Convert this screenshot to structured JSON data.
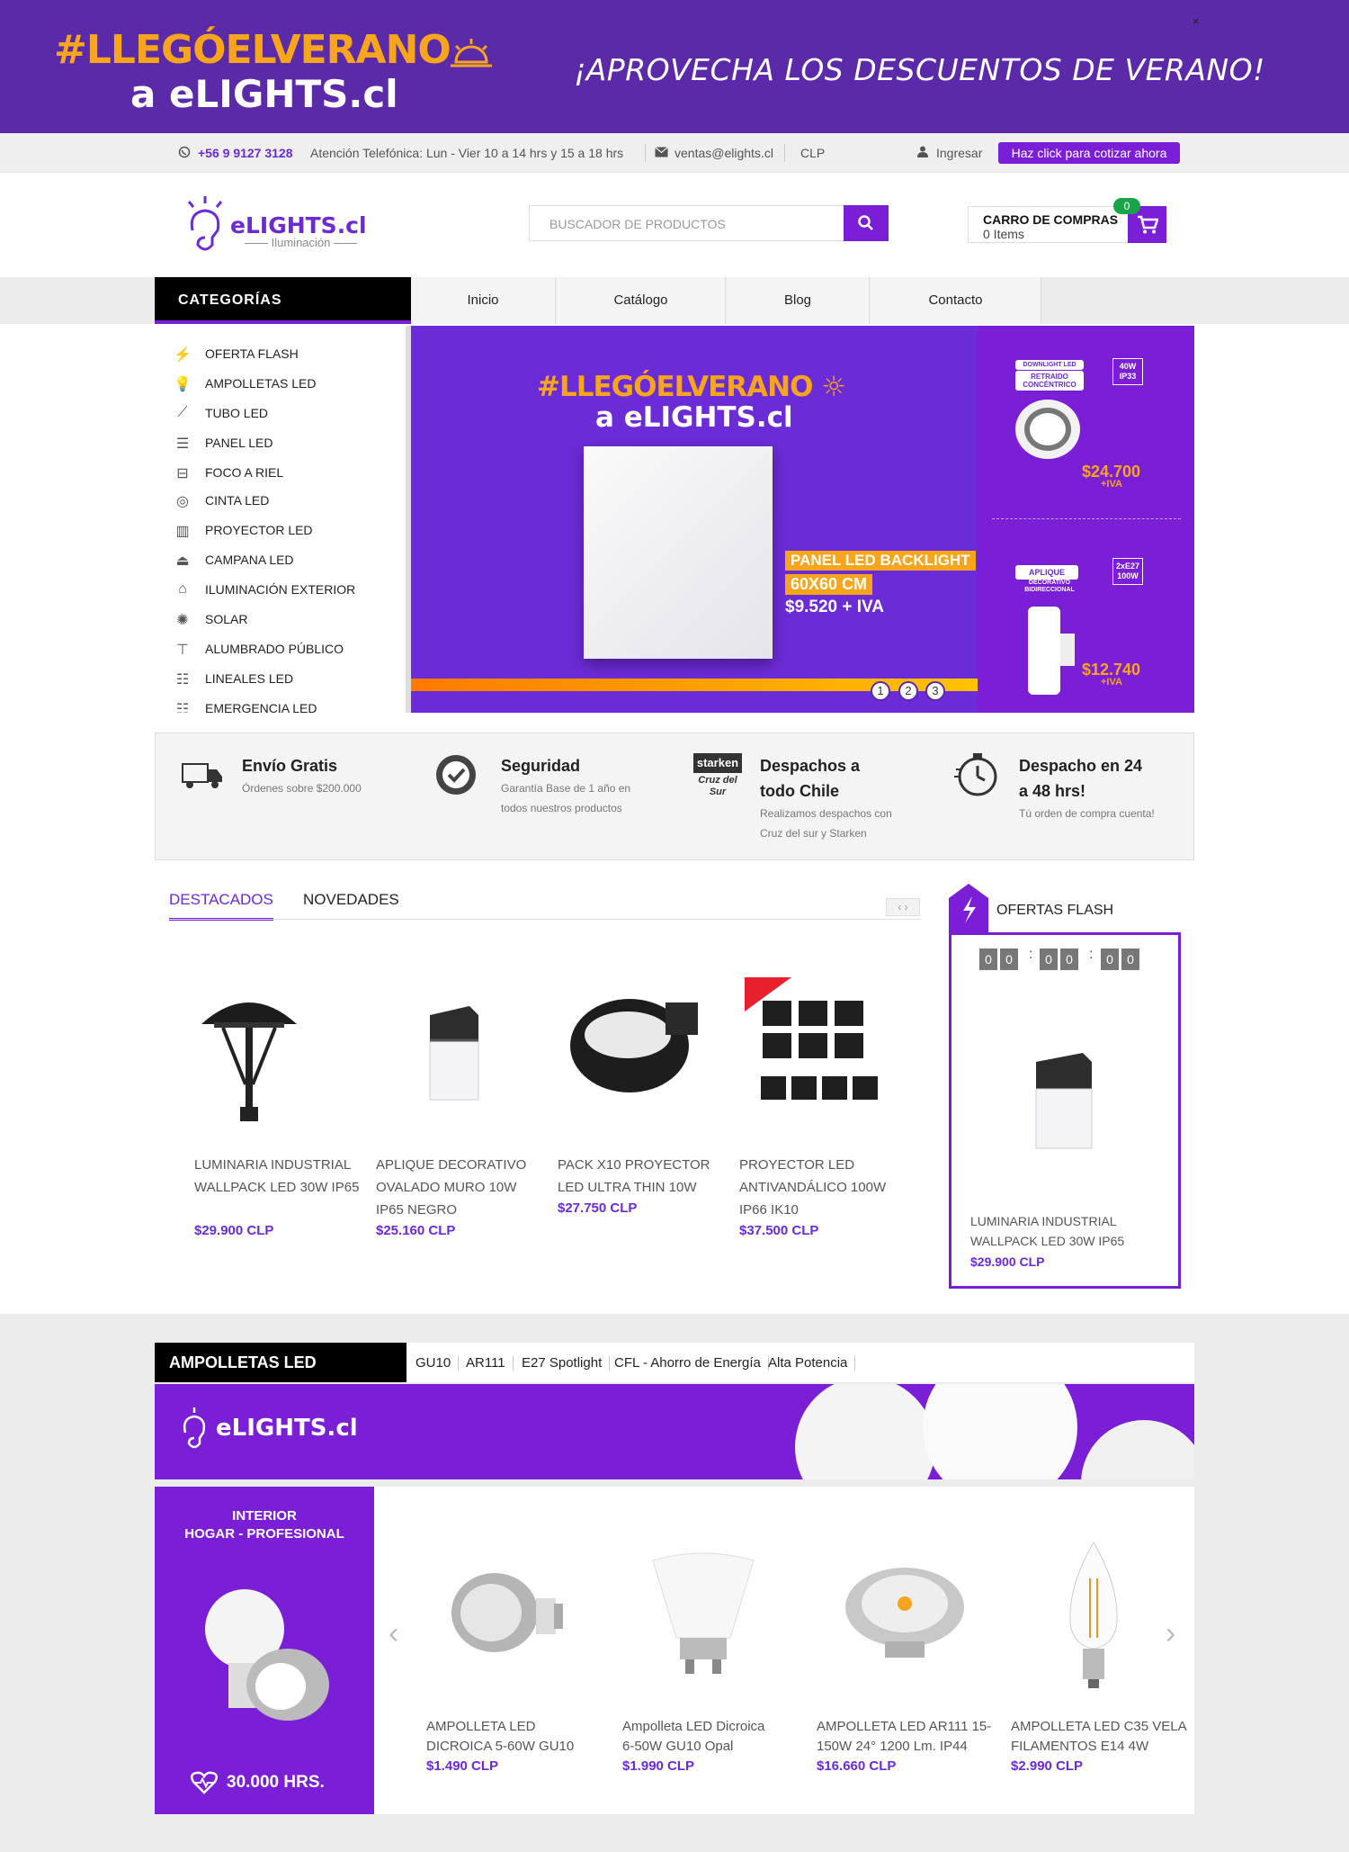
{
  "promo": {
    "tag_prefix": "#LLEGÓEL",
    "tag_highlight": "VERANO",
    "subtitle": "a eLIGHTS.cl",
    "right_text": "¡APROVECHA LOS DESCUENTOS DE VERANO!",
    "close_label": "×"
  },
  "topbar": {
    "phone": "+56 9 9127 3128",
    "hours": "Atención Telefónica: Lun - Vier 10 a 14 hrs y 15 a 18 hrs",
    "email": "ventas@elights.cl",
    "currency": "CLP",
    "login": "Ingresar",
    "quote_button": "Haz click para cotizar ahora"
  },
  "header": {
    "logo_text": "eLIGHTS.cl",
    "logo_sub": "Iluminación",
    "search_placeholder": "BUSCADOR DE PRODUCTOS",
    "cart_title": "CARRO DE COMPRAS",
    "cart_items": "0  Items",
    "cart_count": "0"
  },
  "nav": {
    "categories_label": "CATEGORÍAS",
    "items": [
      "Inicio",
      "Catálogo",
      "Blog",
      "Contacto"
    ]
  },
  "categories": [
    {
      "label": "OFERTA FLASH",
      "icon": "bolt-icon"
    },
    {
      "label": "AMPOLLETAS LED",
      "icon": "bulb-icon"
    },
    {
      "label": "TUBO LED",
      "icon": "tube-icon"
    },
    {
      "label": "PANEL LED",
      "icon": "panel-icon"
    },
    {
      "label": "FOCO A RIEL",
      "icon": "rail-spot-icon"
    },
    {
      "label": "CINTA LED",
      "icon": "strip-icon"
    },
    {
      "label": "PROYECTOR LED",
      "icon": "floodlight-icon"
    },
    {
      "label": "CAMPANA LED",
      "icon": "highbay-icon"
    },
    {
      "label": "ILUMINACIÓN EXTERIOR",
      "icon": "lantern-icon"
    },
    {
      "label": "SOLAR",
      "icon": "sun-icon"
    },
    {
      "label": "ALUMBRADO PÚBLICO",
      "icon": "streetlight-icon"
    },
    {
      "label": "LINEALES LED",
      "icon": "linear-icon"
    },
    {
      "label": "EMERGENCIA LED",
      "icon": "emergency-icon"
    }
  ],
  "hero": {
    "tag_prefix": "#LLEGÓEL",
    "tag_highlight": "VERANO",
    "subtitle": "a eLIGHTS.cl",
    "line1": "PANEL LED BACKLIGHT",
    "line2": "60X60 CM",
    "line3": "$9.520 + IVA",
    "dots": [
      "1",
      "2",
      "3"
    ],
    "active_dot": 1
  },
  "side_promo": {
    "item1": {
      "badge_top": "DOWNLIGHT LED",
      "badge": "RETRAIDO CONCÉNTRICO",
      "spec": "40W IP33",
      "price": "$24.700",
      "iva": "+IVA"
    },
    "item2": {
      "badge": "APLIQUE",
      "badge_sub": "DECORATIVO BIDIRECCIONAL",
      "spec": "2xE27 100W",
      "price": "$12.740",
      "iva": "+IVA"
    }
  },
  "features": [
    {
      "title": "Envío Gratis",
      "desc": "Órdenes sobre $200.000",
      "icon": "truck-icon"
    },
    {
      "title": "Seguridad",
      "desc": "Garantía Base de 1 año en todos nuestros productos",
      "icon": "shield-check-icon"
    },
    {
      "title": "Despachos a todo Chile",
      "desc": "Realizamos despachos con Cruz del sur y Starken",
      "icon": "carrier-logos-icon"
    },
    {
      "title": "Despacho en 24 a 48 hrs!",
      "desc": "Tú orden de compra cuenta!",
      "icon": "stopwatch-icon"
    }
  ],
  "product_tabs": [
    "DESTACADOS",
    "NOVEDADES"
  ],
  "products": [
    {
      "name": "LUMINARIA INDUSTRIAL WALLPACK LED 30W IP65",
      "price": "$29.900 CLP"
    },
    {
      "name": "APLIQUE DECORATIVO OVALADO MURO 10W IP65 NEGRO",
      "price": "$25.160 CLP"
    },
    {
      "name": "PACK x10 PROYECTOR LED ULTRA THIN 10W",
      "price": "$27.750 CLP"
    },
    {
      "name": "PROYECTOR LED ANTIVANDÁLICO 100W IP66 IK10",
      "price": "$37.500 CLP"
    }
  ],
  "flash": {
    "title": "OFERTAS FLASH",
    "countdown": [
      "0",
      "0",
      "0",
      "0",
      "0",
      "0"
    ],
    "product_name": "LUMINARIA INDUSTRIAL WALLPACK LED 30W IP65",
    "product_price": "$29.900 CLP"
  },
  "ampolletas": {
    "title": "AMPOLLETAS LED",
    "tabs": [
      "GU10",
      "AR111",
      "E27 Spotlight",
      "CFL - Ahorro de Energía",
      "Alta Potencia"
    ],
    "banner_logo": "eLIGHTS.cl",
    "side_title": "INTERIOR",
    "side_sub": "HOGAR - PROFESIONAL",
    "side_hours": "30.000 HRS.",
    "products": [
      {
        "name": "AMPOLLETA LED DICROICA 5-60W GU10",
        "price": "$1.490 CLP"
      },
      {
        "name": "Ampolleta LED Dicroica 6-50W GU10 Opal",
        "price": "$1.990 CLP"
      },
      {
        "name": "AMPOLLETA LED AR111 15-150W 24° 1200 Lm. IP44",
        "price": "$16.660 CLP"
      },
      {
        "name": "AMPOLLETA LED C35 VELA FILAMENTOS E14 4W",
        "price": "$2.990 CLP"
      }
    ]
  },
  "colors": {
    "brand": "#7b1fd6",
    "promo_bg": "#5b2aa8",
    "accent": "#f7a51c",
    "badge": "#1aa34a"
  }
}
